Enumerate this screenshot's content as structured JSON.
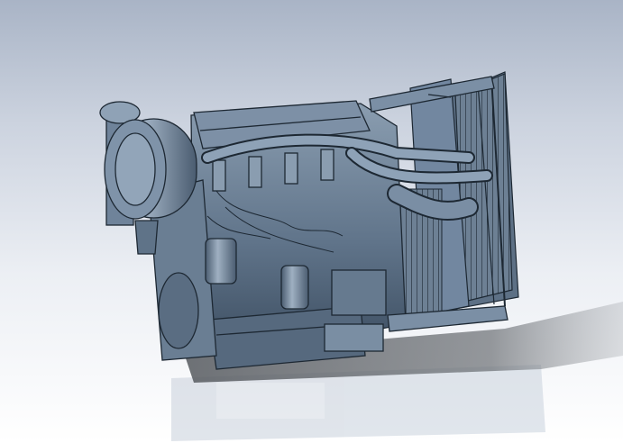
{
  "scene": {
    "subject": "engine-3d-model",
    "colors": {
      "background_top": "#a9b4c6",
      "background_bottom": "#ffffff",
      "body": "#60748a",
      "body_light": "#8a9db0",
      "body_dark": "#3c4d60",
      "edge": "#1d2833",
      "shadow": "#4b4f54",
      "reflection": "#c9d1dc"
    }
  }
}
